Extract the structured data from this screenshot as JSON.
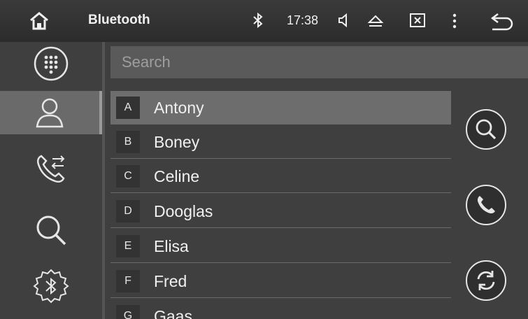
{
  "status_bar": {
    "title": "Bluetooth",
    "time": "17:38",
    "icons": [
      "home-icon",
      "bluetooth-icon",
      "volume-icon",
      "eject-icon",
      "media-icon",
      "more-icon",
      "back-icon"
    ]
  },
  "left_nav": {
    "items": [
      {
        "id": "dialpad",
        "icon": "dialpad-icon",
        "active": false
      },
      {
        "id": "contacts",
        "icon": "person-icon",
        "active": true
      },
      {
        "id": "call-log",
        "icon": "call-transfer-icon",
        "active": false
      },
      {
        "id": "search",
        "icon": "search-icon",
        "active": false
      },
      {
        "id": "bt-settings",
        "icon": "bluetooth-gear-icon",
        "active": false
      }
    ]
  },
  "search": {
    "placeholder": "Search",
    "value": ""
  },
  "contacts": [
    {
      "letter": "A",
      "name": "Antony",
      "selected": true
    },
    {
      "letter": "B",
      "name": "Boney",
      "selected": false
    },
    {
      "letter": "C",
      "name": "Celine",
      "selected": false
    },
    {
      "letter": "D",
      "name": "Dooglas",
      "selected": false
    },
    {
      "letter": "E",
      "name": "Elisa",
      "selected": false
    },
    {
      "letter": "F",
      "name": "Fred",
      "selected": false
    },
    {
      "letter": "G",
      "name": "Gaas",
      "selected": false
    }
  ],
  "actions": [
    "search-icon",
    "phone-icon",
    "sync-icon"
  ],
  "colors": {
    "background": "#3f3f3f",
    "selected_row": "#6d6d6d",
    "active_nav": "#6a6a6a"
  }
}
